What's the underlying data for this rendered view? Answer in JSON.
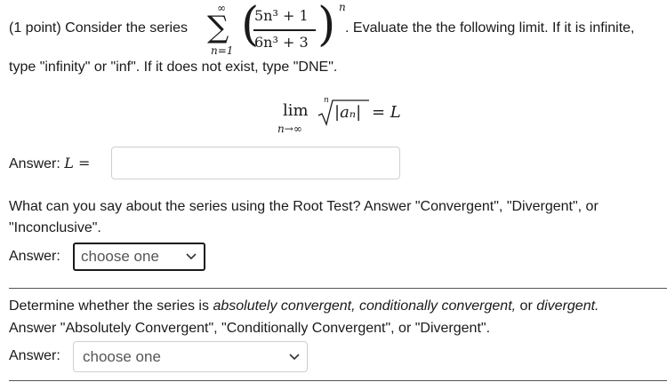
{
  "problem": {
    "intro": "(1 point) Consider the series",
    "sum_upper": "∞",
    "sum_lower": "n=1",
    "numerator": "5n³ + 1",
    "denominator": "6n³ + 3",
    "exponent": "n",
    "after": ". Evaluate the the following limit. If it is infinite,",
    "line2": "type \"infinity\" or \"inf\". If it does not exist, type \"DNE\"."
  },
  "limit": {
    "lim": "lim",
    "sub": "n→∞",
    "root_index": "n",
    "radicand": "|aₙ|",
    "equals": "= L"
  },
  "answer1": {
    "label": "Answer: ",
    "var": "L =",
    "value": ""
  },
  "question2": {
    "line1": "What can you say about the series using the Root Test? Answer \"Convergent\", \"Divergent\", or",
    "line2": "\"Inconclusive\"."
  },
  "answer2": {
    "label": "Answer:",
    "selected": "choose one"
  },
  "question3": {
    "line1_a": "Determine whether the series is ",
    "line1_b": "absolutely convergent, conditionally convergent,",
    "line1_c": " or ",
    "line1_d": "divergent.",
    "line2": "Answer \"Absolutely Convergent\", \"Conditionally Convergent\", or \"Divergent\"."
  },
  "answer3": {
    "label": "Answer:",
    "selected": "choose one"
  },
  "icons": {
    "dropdown": "chevron-down-icon"
  }
}
